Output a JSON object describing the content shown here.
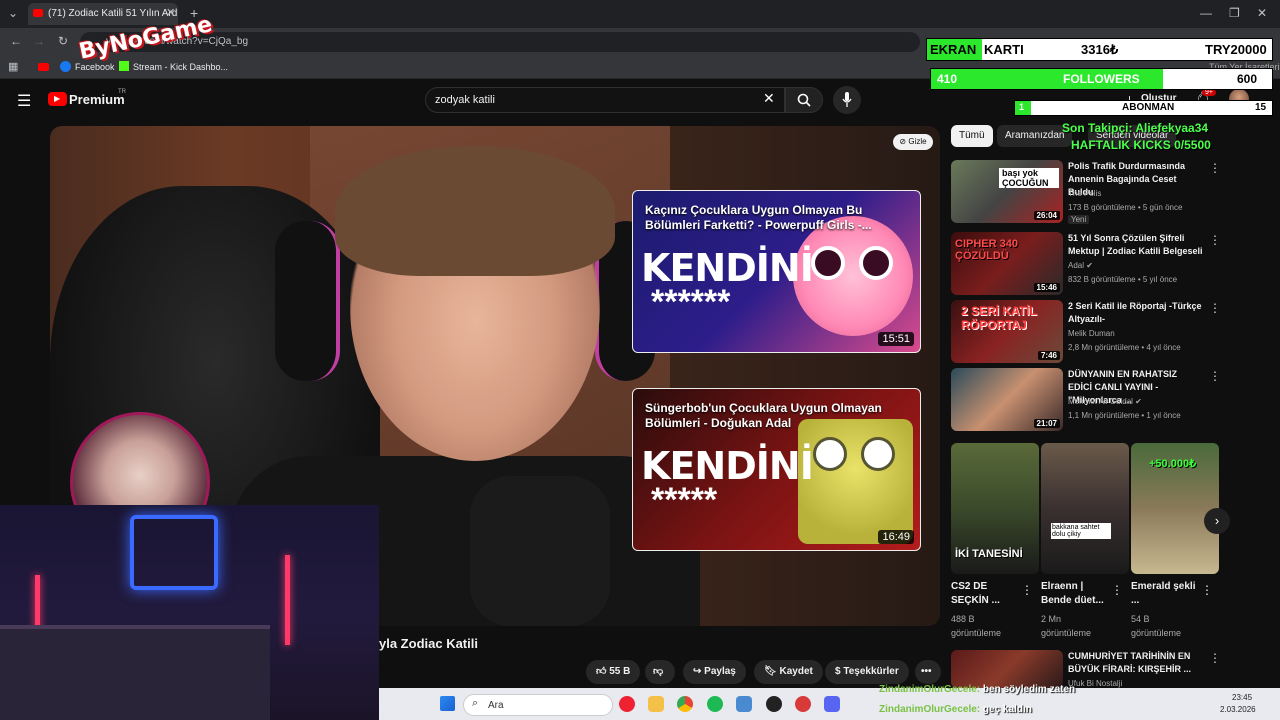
{
  "browser": {
    "tab_title": "(71) Zodiac Katili 51 Yılın Ardına",
    "url": "youtube.com/watch?v=CjQa_bg",
    "bookmarks": [
      "Facebook",
      "Stream - Kick Dashbo..."
    ],
    "all_bookmarks": "Tüm Yer İşaretleri"
  },
  "youtube": {
    "logo_text": "Premium",
    "logo_tr": "TR",
    "search_value": "zodyak katili",
    "create_label": "Oluştur",
    "notif_count": "9+"
  },
  "video": {
    "hide_label": "Gizle",
    "title_fragment": "yla Zodiac Katili",
    "likes": "55 B",
    "share": "Paylaş",
    "save": "Kaydet",
    "thanks": "Teşekkürler",
    "endcards": [
      {
        "title": "Kaçınız Çocuklara Uygun Olmayan Bu Bölümleri Farketti? - Powerpuff Girls -...",
        "big": "KENDİNİ",
        "stars": "******",
        "duration": "15:51"
      },
      {
        "title": "Süngerbob'un Çocuklara Uygun Olmayan Bölümleri - Doğukan Adal",
        "big": "KENDİNİ",
        "stars": "*****",
        "duration": "16:49"
      }
    ]
  },
  "sidebar": {
    "chips": [
      "Tümü",
      "Aramanızdan",
      "Senden videolar"
    ],
    "recs": [
      {
        "title": "Polis Trafik Durdurmasında Annenin Bagajında Ceset Buldu",
        "channel": "The Polis",
        "meta": "173 B görüntüleme • 5 gün önce",
        "badge": "Yeni",
        "duration": "26:04",
        "thumb_text": "başı yok ÇOCUĞUN"
      },
      {
        "title": "51 Yıl Sonra Çözülen Şifreli Mektup | Zodiac Katili Belgeseli",
        "channel": "Adal",
        "meta": "832 B görüntüleme • 5 yıl önce",
        "duration": "15:46",
        "thumb_text": "CIPHER 340 ÇÖZÜLDÜ"
      },
      {
        "title": "2 Seri Katil ile Röportaj -Türkçe Altyazılı-",
        "channel": "Melik Duman",
        "meta": "2,8 Mn görüntüleme • 4 yıl önce",
        "duration": "7:46",
        "thumb_text": "2 SERİ KATİL RÖPORTAJ"
      },
      {
        "title": "DÜNYANIN EN RAHATSIZ EDİCİ CANLI YAYINI - \"Milyonlarca ...",
        "channel": "Mehmet Ali Güldal",
        "meta": "1,1 Mn görüntüleme • 1 yıl önce",
        "duration": "21:07",
        "thumb_text": ""
      },
      {
        "title": "CUMHURİYET TARİHİNİN EN BÜYÜK FİRARİ: KIRŞEHİR ...",
        "channel": "Ufuk Bi Nostalji",
        "meta": "",
        "duration": "",
        "thumb_text": ""
      }
    ],
    "shorts": [
      {
        "title": "CS2 DE SEÇKİN ...",
        "views": "488 B görüntüleme",
        "thumb_text": "İKİ TANESİNİ"
      },
      {
        "title": "Elraenn | Bende düet...",
        "views": "2 Mn görüntüleme",
        "thumb_text": "bakkana sahtet dolu çikiy"
      },
      {
        "title": "Emerald şekli ...",
        "views": "54 B görüntüleme",
        "thumb_text": "+50.000₺"
      }
    ]
  },
  "overlay": {
    "brand": "ByNoGame",
    "gpu_label_a": "EKRAN",
    "gpu_label_b": "KARTI",
    "gpu_amount": "3316₺",
    "gpu_goal": "TRY20000",
    "followers_current": "410",
    "followers_label": "FOLLOWERS",
    "followers_goal": "600",
    "subs_current": "1",
    "subs_label": "ABONMAN",
    "subs_goal": "15",
    "last_follower": "Son Takipçi: Aliefekyaa34",
    "weekly_kicks": "HAFTALIK KICKS 0/5500",
    "chat": [
      {
        "user": "ZindanimOlurGecele:",
        "msg": "ben söyledim zaten"
      },
      {
        "user": "ZindanimOlurGecele:",
        "msg": "geç kaldın"
      }
    ]
  },
  "taskbar": {
    "search": "Ara",
    "time": "23:45",
    "date": "2.03.2026"
  }
}
